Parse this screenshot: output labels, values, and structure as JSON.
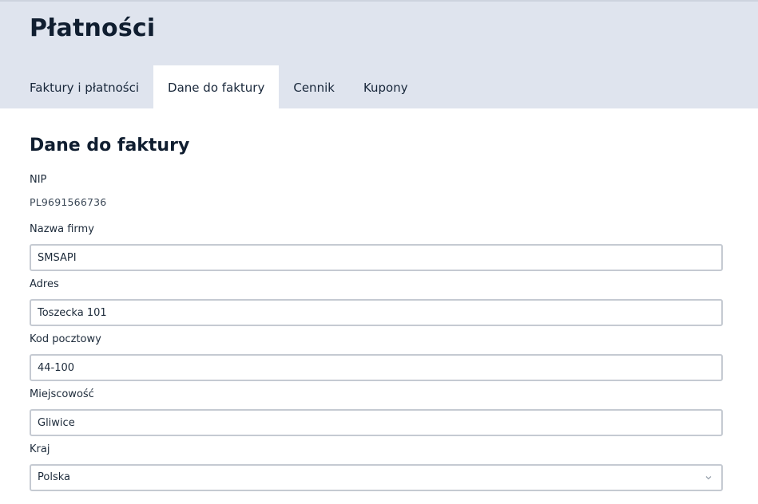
{
  "header": {
    "title": "Płatności",
    "tabs": [
      {
        "label": "Faktury i płatności"
      },
      {
        "label": "Dane do faktury"
      },
      {
        "label": "Cennik"
      },
      {
        "label": "Kupony"
      }
    ]
  },
  "form": {
    "title": "Dane do faktury",
    "nip": {
      "label": "NIP",
      "value": "PL9691566736"
    },
    "company": {
      "label": "Nazwa firmy",
      "value": "SMSAPI"
    },
    "address": {
      "label": "Adres",
      "value": "Toszecka 101"
    },
    "postal": {
      "label": "Kod pocztowy",
      "value": "44-100"
    },
    "city": {
      "label": "Miejscowość",
      "value": "Gliwice"
    },
    "country": {
      "label": "Kraj",
      "value": "Polska"
    }
  },
  "icons": {
    "country_dropdown": "chevron-down-icon"
  },
  "colors": {
    "header_bg": "#dfe4ee",
    "active_tab_bg": "#ffffff",
    "field_border": "#c5cad2"
  }
}
